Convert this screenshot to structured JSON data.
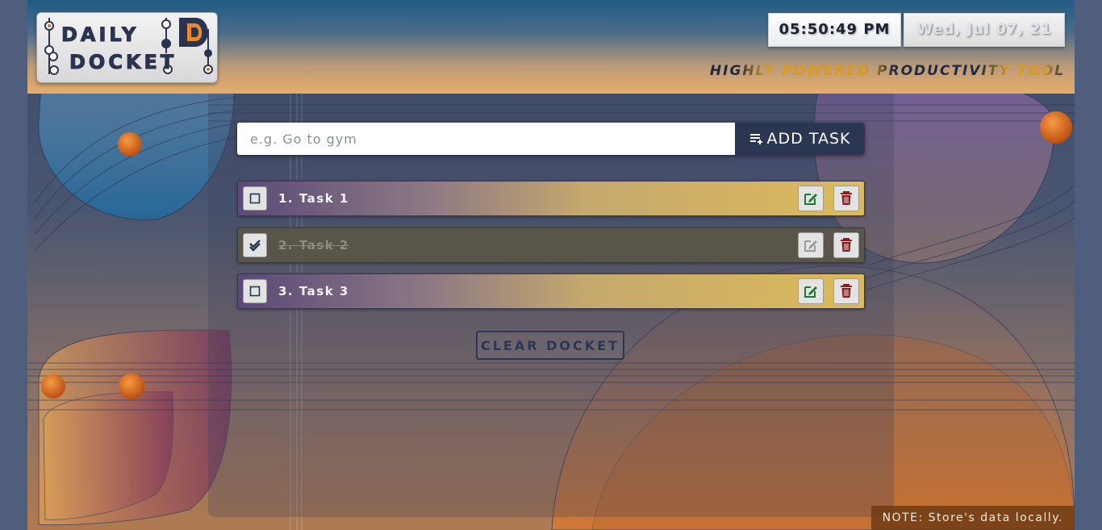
{
  "app": {
    "logo_line1": "DAILY",
    "logo_line2": "DOCKET",
    "logo_mark": "D",
    "tagline": "HIGHLY POWERED PRODUCTIVITY TOOL"
  },
  "clock": {
    "time": "05:50:49 PM",
    "date": "Wed, Jul 07, 21"
  },
  "add_task": {
    "placeholder": "e.g. Go to gym",
    "value": "",
    "button_label": "ADD TASK",
    "button_icon": "playlist-add-icon"
  },
  "tasks": [
    {
      "label": "1. Task 1",
      "completed": false
    },
    {
      "label": "2. Task 2",
      "completed": true
    },
    {
      "label": "3. Task 3",
      "completed": false
    }
  ],
  "actions": {
    "clear_label": "CLEAR DOCKET",
    "edit_icon": "edit-icon",
    "delete_icon": "trash-icon"
  },
  "footer": {
    "note": "NOTE: Store's data locally."
  },
  "colors": {
    "accent": "#2b3653",
    "highlight": "#d99a1e",
    "task_gradient_end": "#ddbb5a",
    "edit_icon": "#1f7a2e",
    "delete_icon": "#8a1e1e"
  }
}
